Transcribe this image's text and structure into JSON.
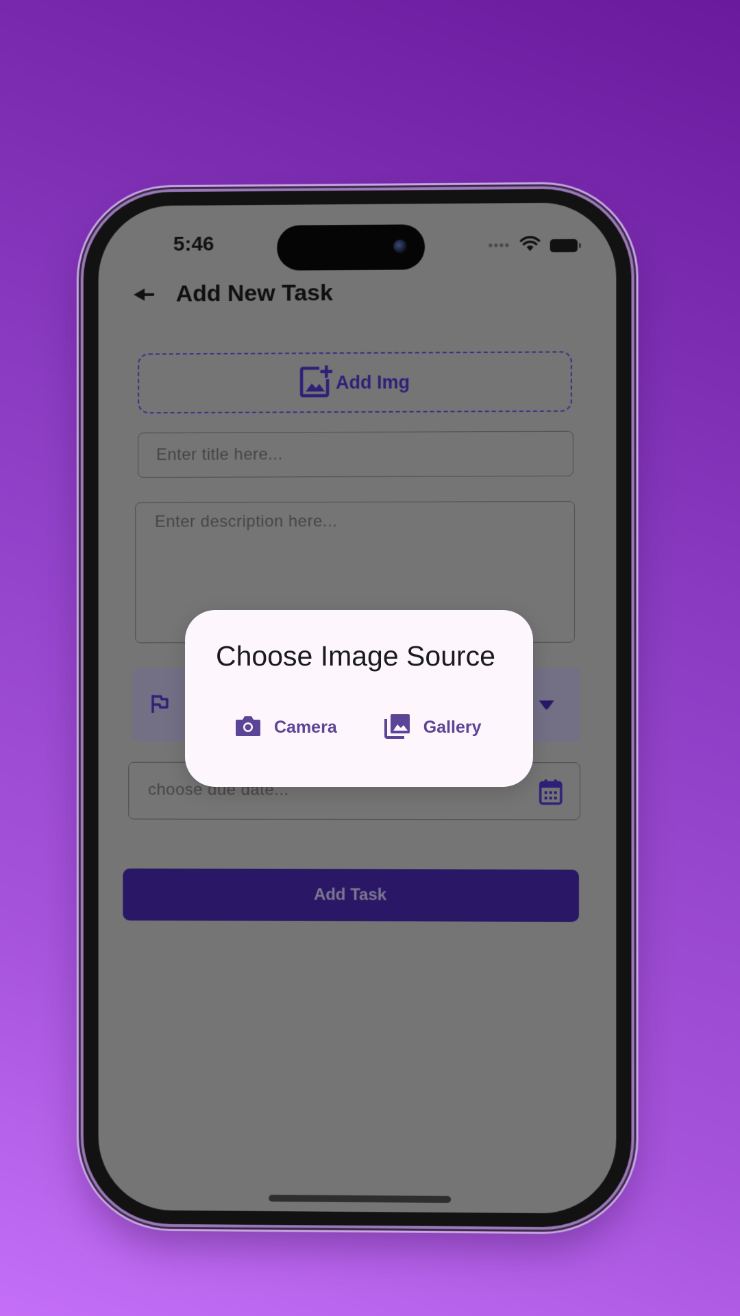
{
  "status_bar": {
    "time": "5:46",
    "signal_dots": "••••"
  },
  "app_bar": {
    "title": "Add New Task"
  },
  "form": {
    "add_img_label": "Add Img",
    "title_placeholder": "Enter title here...",
    "description_placeholder": "Enter description here...",
    "due_date_placeholder": "choose due date...",
    "submit_label": "Add Task"
  },
  "dialog": {
    "title": "Choose Image Source",
    "camera_label": "Camera",
    "gallery_label": "Gallery"
  },
  "icons": {
    "back": "back-arrow-icon",
    "add_image": "add-photo-icon",
    "flag": "flag-icon",
    "dropdown": "dropdown-arrow-icon",
    "calendar": "calendar-icon",
    "camera": "camera-icon",
    "gallery": "photo-library-icon",
    "wifi": "wifi-icon",
    "battery": "battery-icon"
  },
  "colors": {
    "accent": "#2f1f78",
    "button_bg": "#2a1766",
    "dialog_bg": "#fdf7fd",
    "dialog_button": "#5a4596",
    "scrim": "#757575"
  }
}
